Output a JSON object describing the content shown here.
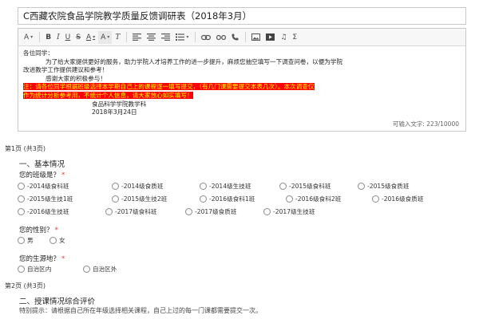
{
  "survey_title": "C西藏农院食品学院教学质量反馈调研表（2018年3月）",
  "toolbar": {
    "heading_icon": "A",
    "bold_icon": "B",
    "italic_icon": "I",
    "underline_icon": "U",
    "strike_icon": "S",
    "font_color_icon": "A",
    "highlight_icon": "A",
    "clear_format_icon": "T",
    "icons": [
      "heading-dropdown",
      "bold",
      "italic",
      "underline",
      "strikethrough",
      "font-color",
      "highlight-color",
      "clear-format",
      "align-left",
      "align-center",
      "align-right",
      "list",
      "link",
      "unlink",
      "phone",
      "image",
      "video",
      "music",
      "formula"
    ]
  },
  "intro": {
    "line1": "各位同学：",
    "line2": "为了给大家提供更好的服务，助力学院人才培养工作的进一步提升，麻烦您抽空填写一下调查问卷，以便为学院",
    "line3": "改进教学工作提供建议和参考！",
    "line4": "感谢大家的积极参与！",
    "line5": "注：请各位同学根据班级选择本学期自己上的课程逐一填写提交，（有几门课需要提交本表几次）。本次调查仅",
    "line6": "作为统计分析参考用，不统计个人信息，请大家放心如实填写！",
    "signature": "食品科学学院教学科",
    "date": "2018年3月24日"
  },
  "counter_text": "可输入文字: 223/10000",
  "page1_label": "第1页 (共3页)",
  "section1_title": "一、基本情况",
  "q_class": {
    "label": "您的班级是？",
    "required": "*",
    "row1": [
      "-2014级食科班",
      "-2014级食质班",
      "-2014级生技班",
      "-2015级食科班",
      "-2015级食质班"
    ],
    "row2": [
      "-2015级生技1班",
      "-2015级生技2班",
      "-2016级食科1班",
      "-2016级食科2班",
      "-2016级食质班"
    ],
    "row3": [
      "-2016级生技班",
      "-2017级食科班",
      "-2017级食质班",
      "-2017级生技班"
    ]
  },
  "q_gender": {
    "label": "您的性别？",
    "required": "*",
    "options": [
      "男",
      "女"
    ]
  },
  "q_origin": {
    "label": "您的生源地？",
    "required": "*",
    "options": [
      "自治区内",
      "自治区外"
    ]
  },
  "page2_label": "第2页 (共3页)",
  "section2_title": "二、授课情况综合评价",
  "section2_note": "特别提示：请根据自己所在年级选择相关课程，自己上过的每一门课都需要提交一次。",
  "colors": {
    "highlight_bg": "#ff0000",
    "highlight_text": "#ffff00",
    "required": "#e53935"
  }
}
